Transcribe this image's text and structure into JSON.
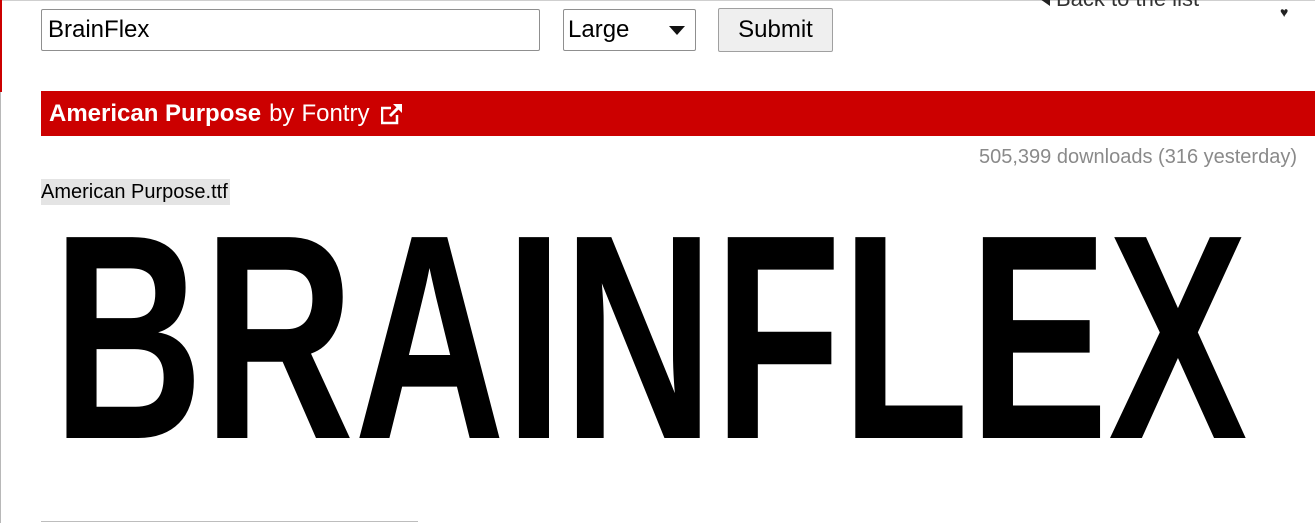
{
  "nav": {
    "back_label": "Back to the list"
  },
  "form": {
    "text_value": "BrainFlex",
    "size_selected": "Large",
    "submit_label": "Submit"
  },
  "font": {
    "name": "American Purpose",
    "by": "by",
    "author": "Fontry",
    "downloads": "505,399 downloads (316 yesterday)",
    "file_name": "American Purpose.ttf",
    "preview_text": "BRAINFLEX"
  },
  "icons": {
    "back": "arrow-left-icon",
    "external": "external-link-icon",
    "favorite": "heart-icon"
  },
  "colors": {
    "bar": "#cc0000",
    "downloads_text": "#8a8a8a",
    "file_name_bg": "#e4e4e4"
  }
}
